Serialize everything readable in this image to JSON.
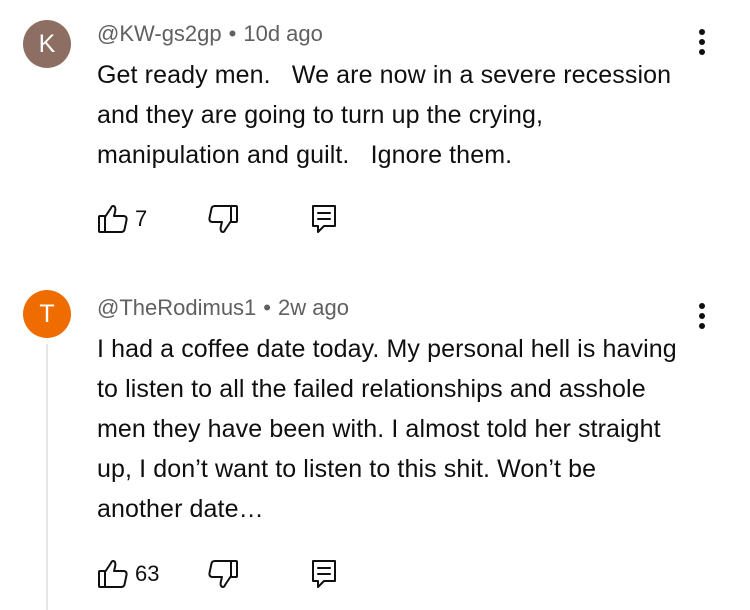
{
  "comments": [
    {
      "avatar_letter": "K",
      "avatar_color": "#8d6e63",
      "author": "@KW-gs2gp",
      "separator": "•",
      "time": "10d ago",
      "text": "Get ready men.   We are now in a severe recession and they are going to turn up the crying, manipulation and guilt.   Ignore them.",
      "likes": "7"
    },
    {
      "avatar_letter": "T",
      "avatar_color": "#ef6c00",
      "author": "@TheRodimus1",
      "separator": "•",
      "time": "2w ago",
      "text": "I had a coffee date today. My personal hell is having to listen to all the failed relationships and asshole men they have been with. I almost told her straight up, I don’t want to listen to this shit. Won’t be another date…",
      "likes": "63"
    }
  ],
  "icons": {
    "like": "thumbs-up-icon",
    "dislike": "thumbs-down-icon",
    "reply": "reply-icon",
    "menu": "more-vertical-icon"
  }
}
